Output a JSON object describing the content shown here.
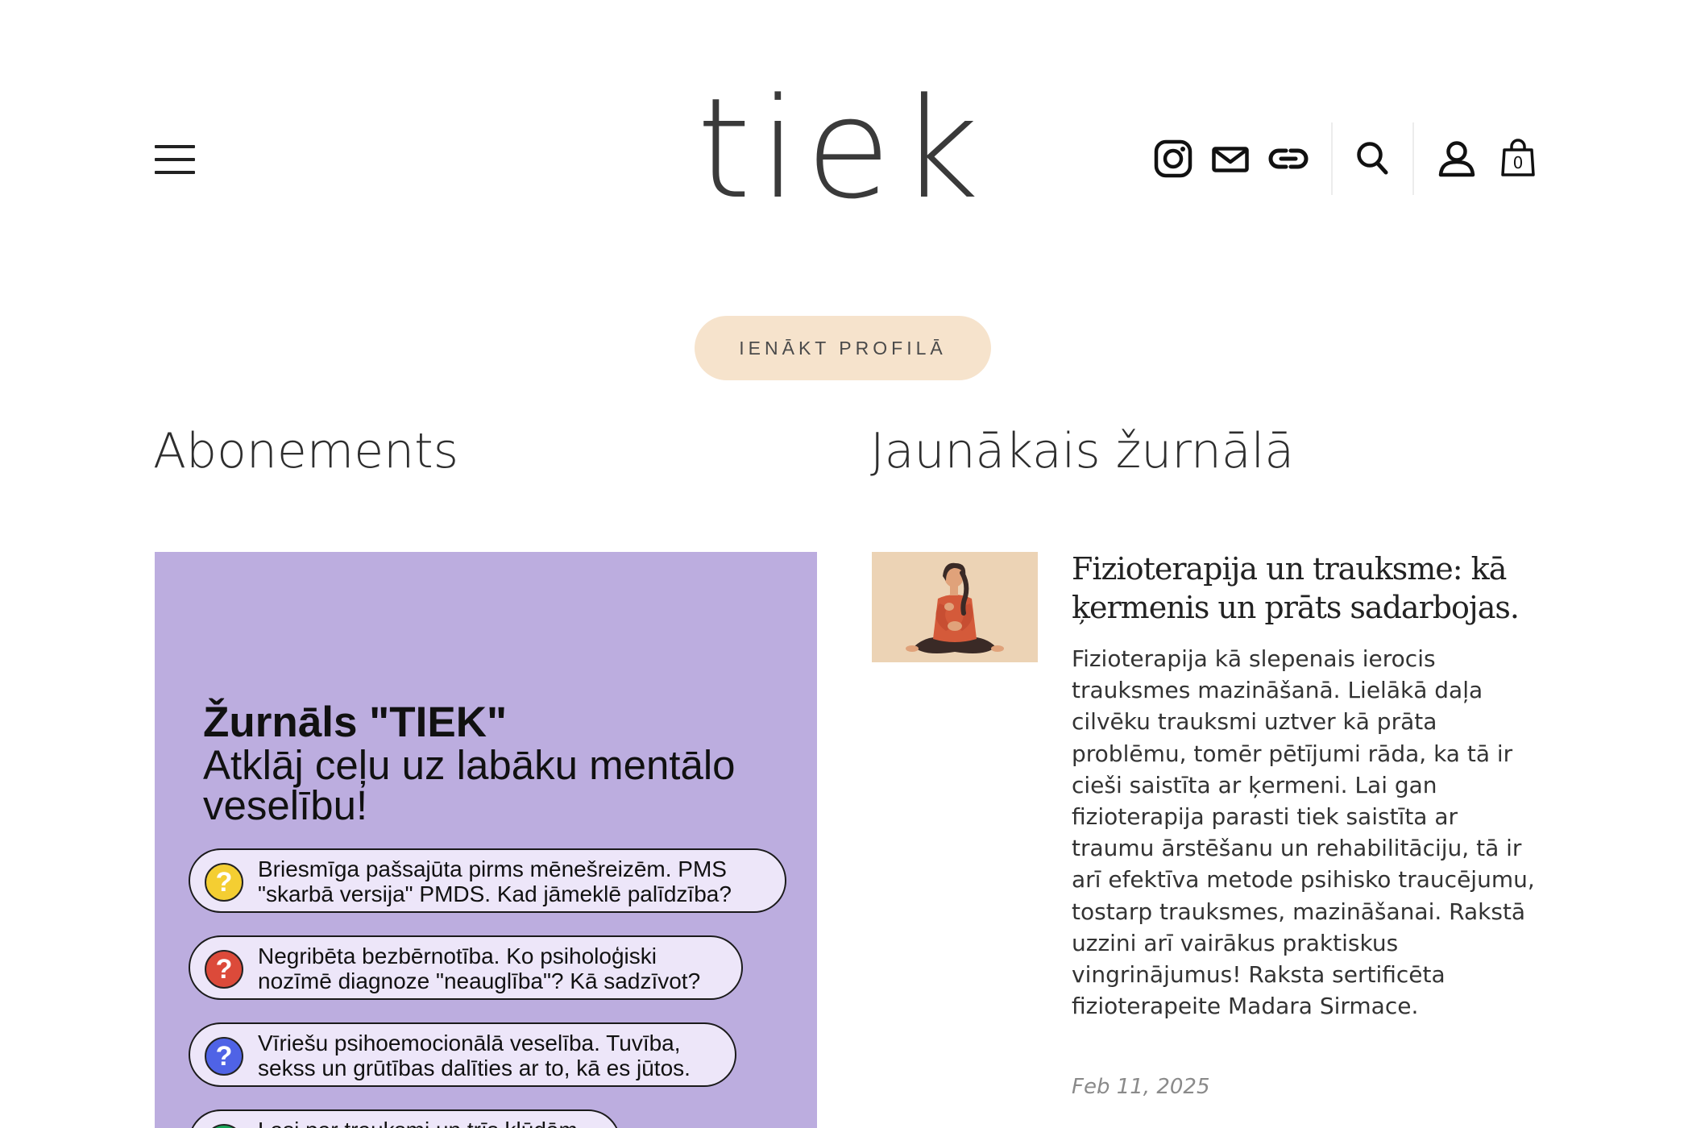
{
  "header": {
    "logo_text": "tiek",
    "menu_icon": "hamburger-icon",
    "social_icons": [
      "instagram-icon",
      "mail-icon",
      "link-icon"
    ],
    "search_icon": "search-icon",
    "account_icon": "user-icon",
    "cart": {
      "icon": "bag-icon",
      "count": "0"
    }
  },
  "login_button": {
    "label": "IENĀKT PROFILĀ"
  },
  "sections": {
    "subscription_title": "Abonements",
    "journal_title": "Jaunākais žurnālā"
  },
  "promo": {
    "title": "Žurnāls \"TIEK\"",
    "subtitle": "Atklāj ceļu uz labāku mentālo veselību!",
    "items": [
      {
        "line1": "Briesmīga pašsajūta pirms mēnešreizēm. PMS",
        "line2": "\"skarbā versija\" PMDS. Kad jāmeklē palīdzība?",
        "color": "#f4ce32"
      },
      {
        "line1": "Negribēta bezbērnotība. Ko psiholoģiski",
        "line2": "nozīmē diagnoze \"neauglība\"? Kā sadzīvot?",
        "color": "#dc4a3a"
      },
      {
        "line1": "Vīriešu psihoemocionālā veselība. Tuvība,",
        "line2": "sekss un grūtības dalīties ar to, kā es jūtos.",
        "color": "#4f63e6"
      },
      {
        "line1": "Lasi par trauksmi un trīs kļūdām",
        "line2": "",
        "color": "#19a85a"
      }
    ],
    "question_mark": "?"
  },
  "article": {
    "title": "Fizioterapija un trauksme: kā ķermenis un prāts sadarbojas.",
    "excerpt": "Fizioterapija kā slepenais ierocis trauksmes mazināšanā. Lielākā daļa cilvēku trauksmi uztver kā prāta problēmu, tomēr pētījumi rāda, ka tā ir cieši saistīta ar ķermeni. Lai gan fizioterapija parasti tiek saistīta ar traumu ārstēšanu un rehabilitāciju, tā ir arī efektīva metode psihisko traucējumu, tostarp trauksmes, mazināšanai. Rakstā uzzini arī vairākus praktiskus vingrinājumus! Raksta sertificēta fizioterapeite Madara Sirmace.",
    "date": "Feb 11, 2025",
    "thumbnail_icon": "meditating-woman-illustration"
  }
}
